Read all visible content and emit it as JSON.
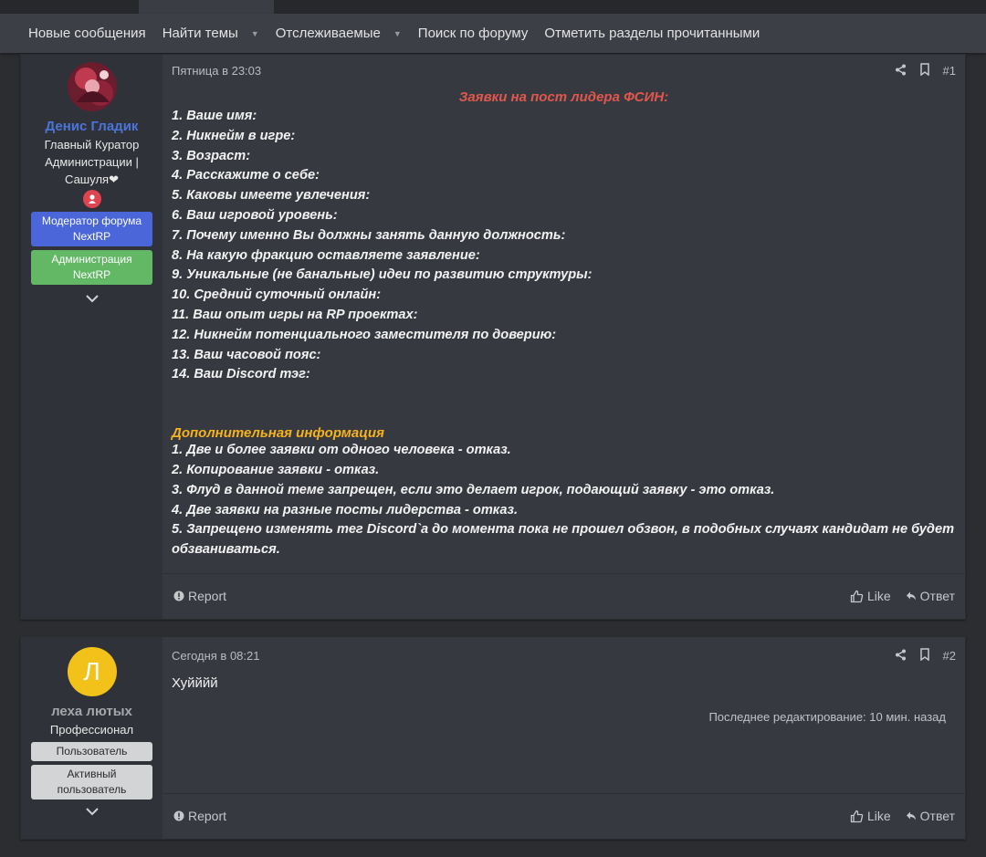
{
  "nav": {
    "items": [
      {
        "label": "Новые сообщения",
        "has_caret": false
      },
      {
        "label": "Найти темы",
        "has_caret": true
      },
      {
        "label": "Отслеживаемые",
        "has_caret": true
      },
      {
        "label": "Поиск по форуму",
        "has_caret": false
      },
      {
        "label": "Отметить разделы прочитанными",
        "has_caret": false
      }
    ]
  },
  "posts": [
    {
      "user": {
        "name": "Денис Гладик",
        "name_color": "#4b74d9",
        "title_lines": [
          "Главный Куратор",
          "Администрации |",
          "Сашуля❤"
        ],
        "banners": [
          {
            "label": "Модератор форума NextRP",
            "color": "#4a66d8"
          },
          {
            "label": "Администрация NextRP",
            "color": "#62b865"
          }
        ]
      },
      "date": "Пятница в 23:03",
      "number": "#1",
      "heading": "Заявки на пост лидера ФСИН:",
      "lines": [
        "1. Ваше имя:",
        "2. Никнейм в игре:",
        "3. Возраст:",
        "4. Расскажите о себе:",
        "5. Каковы имеете увлечения:",
        "6. Ваш игровой уровень:",
        "7. Почему именно Вы должны занять данную должность:",
        "8. На какую фракцию оставляете заявление:",
        "9. Уникальные (не банальные) идеи по развитию структуры:",
        "10. Средний суточный онлайн:",
        "11. Ваш опыт игры на RP проектах:",
        "12. Никнейм потенциального заместителя по доверию:",
        "13. Ваш часовой пояс:",
        "14. Ваш Discord тэг:"
      ],
      "extra_heading": "Дополнительная информация",
      "extra_lines": [
        "1. Две и более заявки от одного человека - отказ.",
        "2. Копирование заявки - отказ.",
        "3. Флуд в данной теме запрещен, если это делает игрок, подающий заявку - это отказ.",
        "4. Две заявки на разные посты лидерства - отказ.",
        "5. Запрещено изменять тег Discord`a до момента пока не прошел обзвон, в подобных случаях кандидат не будет обзваниваться."
      ],
      "report_label": "Report",
      "like_label": "Like",
      "reply_label": "Ответ"
    },
    {
      "user": {
        "name": "леха лютых",
        "avatar_letter": "Л",
        "avatar_color": "#f2c21a",
        "title": "Профессионал",
        "banners": [
          {
            "label": "Пользователь"
          },
          {
            "label": "Активный пользователь"
          }
        ]
      },
      "date": "Сегодня в 08:21",
      "number": "#2",
      "text": "Хуйййй",
      "edited": "Последнее редактирование: 10 мин. назад",
      "report_label": "Report",
      "like_label": "Like",
      "reply_label": "Ответ"
    }
  ]
}
